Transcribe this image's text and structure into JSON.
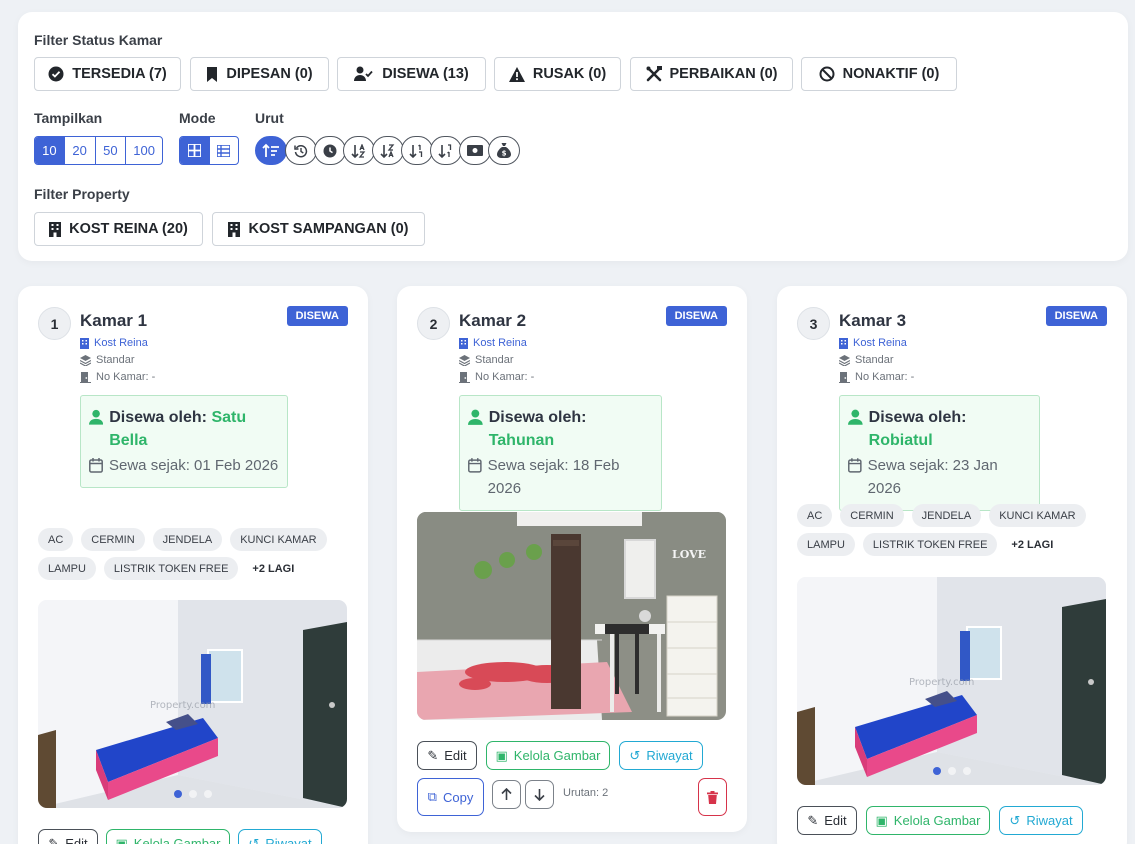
{
  "filters": {
    "status_label": "Filter Status Kamar",
    "status_chips": [
      {
        "label": "TERSEDIA (7)",
        "icon": "check-circle-icon"
      },
      {
        "label": "DIPESAN (0)",
        "icon": "bookmark-icon"
      },
      {
        "label": "DISEWA (13)",
        "icon": "user-check-icon"
      },
      {
        "label": "RUSAK (0)",
        "icon": "warning-icon"
      },
      {
        "label": "PERBAIKAN (0)",
        "icon": "tools-icon"
      },
      {
        "label": "NONAKTIF (0)",
        "icon": "ban-icon"
      }
    ],
    "show_label": "Tampilkan",
    "show_options": [
      "10",
      "20",
      "50",
      "100"
    ],
    "show_selected": "10",
    "mode_label": "Mode",
    "mode_options": [
      "grid-icon",
      "list-icon"
    ],
    "sort_label": "Urut",
    "sort_icons": [
      "sort-number-up-icon",
      "history-icon",
      "clock-icon",
      "sort-alpha-down-icon",
      "sort-alpha-up-icon",
      "sort-numeric-down-icon",
      "sort-numeric-up-icon",
      "money-icon",
      "money-bag-icon"
    ],
    "property_label": "Filter Property",
    "property_chips": [
      {
        "label": "KOST REINA (20)",
        "icon": "building-icon"
      },
      {
        "label": "KOST SAMPANGAN (0)",
        "icon": "building-icon"
      }
    ]
  },
  "rooms": [
    {
      "number": "1",
      "title": "Kamar 1",
      "status": "DISEWA",
      "property": "Kost Reina",
      "type": "Standar",
      "room_no": "No Kamar: -",
      "rented_by_label": "Disewa oleh:",
      "tenant": "Satu Bella",
      "since": "Sewa sejak: 01 Feb 2026",
      "tags": [
        "AC",
        "CERMIN",
        "JENDELA",
        "KUNCI KAMAR",
        "LAMPU",
        "LISTRIK TOKEN FREE"
      ],
      "more": "+2 LAGI",
      "photo": "blue-bed-room-photo",
      "dots": 3,
      "active_dot": 0
    },
    {
      "number": "2",
      "title": "Kamar 2",
      "status": "DISEWA",
      "property": "Kost Reina",
      "type": "Standar",
      "room_no": "No Kamar: -",
      "rented_by_label": "Disewa oleh:",
      "tenant": "Tahunan",
      "since": "Sewa sejak: 18 Feb 2026",
      "tags": [],
      "more": "",
      "photo": "pink-mattress-room-photo",
      "dots": 0
    },
    {
      "number": "3",
      "title": "Kamar 3",
      "status": "DISEWA",
      "property": "Kost Reina",
      "type": "Standar",
      "room_no": "No Kamar: -",
      "rented_by_label": "Disewa oleh:",
      "tenant": "Robiatul",
      "since": "Sewa sejak: 23 Jan 2026",
      "tags": [
        "AC",
        "CERMIN",
        "JENDELA",
        "KUNCI KAMAR",
        "LAMPU",
        "LISTRIK TOKEN FREE"
      ],
      "more": "+2 LAGI",
      "photo": "blue-bed-room-photo",
      "dots": 3,
      "active_dot": 0
    }
  ],
  "actions": {
    "edit": "Edit",
    "manage_images": "Kelola Gambar",
    "history": "Riwayat",
    "copy": "Copy",
    "order": "Urutan: 2"
  },
  "watermark": "Property.com",
  "colors": {
    "primary": "#3e63d6",
    "success": "#2fb56a",
    "info": "#22a9d3",
    "danger": "#d6334a"
  }
}
